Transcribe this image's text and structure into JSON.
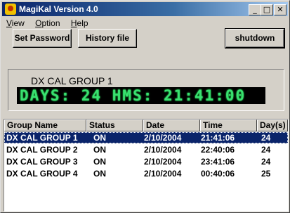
{
  "window": {
    "title": "MagiKal Version 4.0"
  },
  "menu": [
    {
      "mnemonic": "V",
      "rest": "iew"
    },
    {
      "mnemonic": "O",
      "rest": "ption"
    },
    {
      "mnemonic": "H",
      "rest": "elp"
    }
  ],
  "toolbar": {
    "set_password": "Set Password",
    "history_file": "History file",
    "shutdown": "shutdown"
  },
  "display": {
    "group": "DX CAL GROUP 1",
    "readout": "DAYS: 24 HMS: 21:41:00"
  },
  "table": {
    "headers": [
      "Group Name",
      "Status",
      "Date",
      "Time",
      "Day(s) I"
    ],
    "rows": [
      [
        "DX CAL GROUP 1",
        "ON",
        "2/10/2004",
        "21:41:06",
        "24"
      ],
      [
        "DX CAL GROUP 2",
        "ON",
        "2/10/2004",
        "22:40:06",
        "24"
      ],
      [
        "DX CAL GROUP 3",
        "ON",
        "2/10/2004",
        "23:41:06",
        "24"
      ],
      [
        "DX CAL GROUP 4",
        "ON",
        "2/10/2004",
        "00:40:06",
        "25"
      ]
    ],
    "selected_index": 0
  },
  "colors": {
    "title_bar": "#0a246a",
    "selection": "#0a246a",
    "display_text": "#39e070"
  }
}
